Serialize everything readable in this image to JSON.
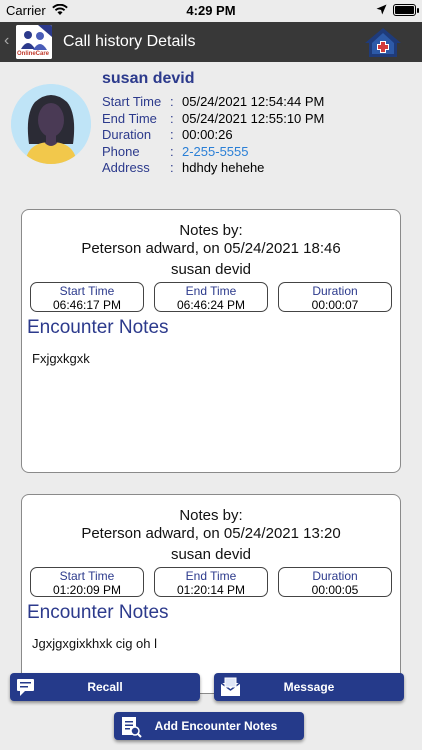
{
  "status_bar": {
    "carrier": "Carrier",
    "time": "4:29 PM"
  },
  "nav": {
    "title": "Call history Details",
    "back_icon": "chevron-left-icon",
    "home_icon": "home-icon",
    "logo_text": "OnlineCare"
  },
  "patient": {
    "name": "susan devid",
    "rows": [
      {
        "label": "Start Time",
        "sep": ":",
        "value": "05/24/2021 12:54:44 PM"
      },
      {
        "label": "End Time",
        "sep": ":",
        "value": "05/24/2021 12:55:10 PM"
      },
      {
        "label": "Duration",
        "sep": ":",
        "value": "00:00:26"
      },
      {
        "label": "Phone",
        "sep": ":",
        "value": "2-255-5555"
      },
      {
        "label": "Address",
        "sep": ":",
        "value": "hdhdy hehehe"
      }
    ]
  },
  "notes": [
    {
      "header": "Notes by:",
      "byline": "Peterson adward, on 05/24/2021 18:46",
      "patient": "susan devid",
      "start_label": "Start Time",
      "start_value": "06:46:17 PM",
      "end_label": "End Time",
      "end_value": "06:46:24 PM",
      "duration_label": "Duration",
      "duration_value": "00:00:07",
      "section_title": "Encounter Notes",
      "text": "Fxjgxkgxk"
    },
    {
      "header": "Notes by:",
      "byline": "Peterson adward, on 05/24/2021 13:20",
      "patient": "susan devid",
      "start_label": "Start Time",
      "start_value": "01:20:09 PM",
      "end_label": "End Time",
      "end_value": "01:20:14 PM",
      "duration_label": "Duration",
      "duration_value": "00:00:05",
      "section_title": "Encounter Notes",
      "text": "Jgxjgxgixkhxk cig oh l"
    }
  ],
  "buttons": {
    "recall": "Recall",
    "message": "Message",
    "add_notes": "Add Encounter Notes"
  },
  "colors": {
    "accent": "#2c3a8c",
    "button": "#253a8a",
    "link": "#2a7fd6",
    "nav": "#383838"
  }
}
